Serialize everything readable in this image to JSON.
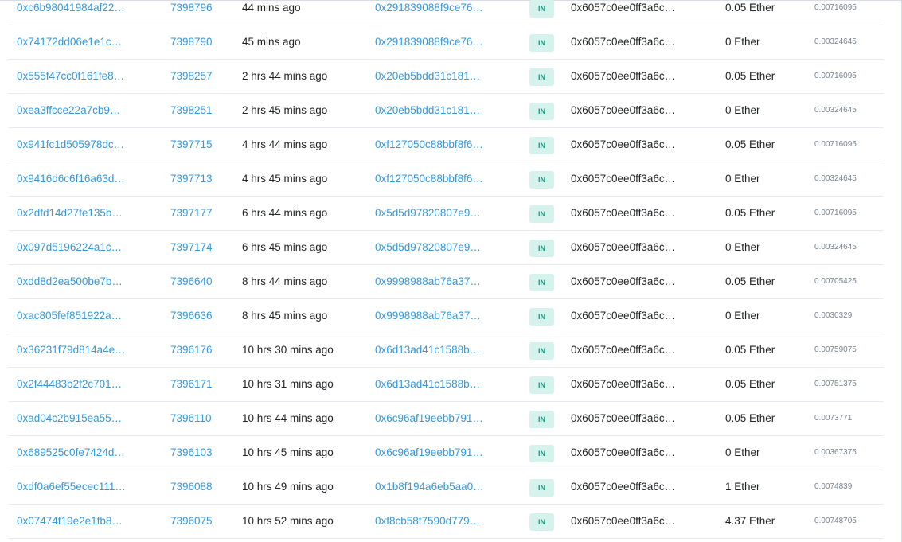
{
  "transactions": [
    {
      "hash": "0xc6b98041984af22…",
      "block": "7398796",
      "age": "44 mins ago",
      "from": "0x291839088f9ce76…",
      "direction": "IN",
      "to": "0x6057c0ee0ff3a6c…",
      "value": "0.05 Ether",
      "fee": "0.00716095"
    },
    {
      "hash": "0x74172dd06e1e1c…",
      "block": "7398790",
      "age": "45 mins ago",
      "from": "0x291839088f9ce76…",
      "direction": "IN",
      "to": "0x6057c0ee0ff3a6c…",
      "value": "0 Ether",
      "fee": "0.00324645"
    },
    {
      "hash": "0x555f47cc0f161fe8…",
      "block": "7398257",
      "age": "2 hrs 44 mins ago",
      "from": "0x20eb5bdd31c181…",
      "direction": "IN",
      "to": "0x6057c0ee0ff3a6c…",
      "value": "0.05 Ether",
      "fee": "0.00716095"
    },
    {
      "hash": "0xea3ffcce22a7cb9…",
      "block": "7398251",
      "age": "2 hrs 45 mins ago",
      "from": "0x20eb5bdd31c181…",
      "direction": "IN",
      "to": "0x6057c0ee0ff3a6c…",
      "value": "0 Ether",
      "fee": "0.00324645"
    },
    {
      "hash": "0x941fc1d505978dc…",
      "block": "7397715",
      "age": "4 hrs 44 mins ago",
      "from": "0xf127050c88bbf8f6…",
      "direction": "IN",
      "to": "0x6057c0ee0ff3a6c…",
      "value": "0.05 Ether",
      "fee": "0.00716095"
    },
    {
      "hash": "0x9416d6c6f16a63d…",
      "block": "7397713",
      "age": "4 hrs 45 mins ago",
      "from": "0xf127050c88bbf8f6…",
      "direction": "IN",
      "to": "0x6057c0ee0ff3a6c…",
      "value": "0 Ether",
      "fee": "0.00324645"
    },
    {
      "hash": "0x2dfd14d27fe135b…",
      "block": "7397177",
      "age": "6 hrs 44 mins ago",
      "from": "0x5d5d97820807e9…",
      "direction": "IN",
      "to": "0x6057c0ee0ff3a6c…",
      "value": "0.05 Ether",
      "fee": "0.00716095"
    },
    {
      "hash": "0x097d5196224a1c…",
      "block": "7397174",
      "age": "6 hrs 45 mins ago",
      "from": "0x5d5d97820807e9…",
      "direction": "IN",
      "to": "0x6057c0ee0ff3a6c…",
      "value": "0 Ether",
      "fee": "0.00324645"
    },
    {
      "hash": "0xdd8d2ea500be7b…",
      "block": "7396640",
      "age": "8 hrs 44 mins ago",
      "from": "0x9998988ab76a37…",
      "direction": "IN",
      "to": "0x6057c0ee0ff3a6c…",
      "value": "0.05 Ether",
      "fee": "0.00705425"
    },
    {
      "hash": "0xac805fef851922a…",
      "block": "7396636",
      "age": "8 hrs 45 mins ago",
      "from": "0x9998988ab76a37…",
      "direction": "IN",
      "to": "0x6057c0ee0ff3a6c…",
      "value": "0 Ether",
      "fee": "0.0030329"
    },
    {
      "hash": "0x36231f79d814a4e…",
      "block": "7396176",
      "age": "10 hrs 30 mins ago",
      "from": "0x6d13ad41c1588b…",
      "direction": "IN",
      "to": "0x6057c0ee0ff3a6c…",
      "value": "0.05 Ether",
      "fee": "0.00759075"
    },
    {
      "hash": "0x2f44483b2f2c701…",
      "block": "7396171",
      "age": "10 hrs 31 mins ago",
      "from": "0x6d13ad41c1588b…",
      "direction": "IN",
      "to": "0x6057c0ee0ff3a6c…",
      "value": "0.05 Ether",
      "fee": "0.00751375"
    },
    {
      "hash": "0xad04c2b915ea55…",
      "block": "7396110",
      "age": "10 hrs 44 mins ago",
      "from": "0x6c96af19eebb791…",
      "direction": "IN",
      "to": "0x6057c0ee0ff3a6c…",
      "value": "0.05 Ether",
      "fee": "0.0073771"
    },
    {
      "hash": "0x689525c0fe7424d…",
      "block": "7396103",
      "age": "10 hrs 45 mins ago",
      "from": "0x6c96af19eebb791…",
      "direction": "IN",
      "to": "0x6057c0ee0ff3a6c…",
      "value": "0 Ether",
      "fee": "0.00367375"
    },
    {
      "hash": "0xdf0a6ef55ecec111…",
      "block": "7396088",
      "age": "10 hrs 49 mins ago",
      "from": "0x1b8f194a6eb5aa0…",
      "direction": "IN",
      "to": "0x6057c0ee0ff3a6c…",
      "value": "1 Ether",
      "fee": "0.0074839"
    },
    {
      "hash": "0x07474f19e2e1fb8…",
      "block": "7396075",
      "age": "10 hrs 52 mins ago",
      "from": "0xf8cb58f7590d779…",
      "direction": "IN",
      "to": "0x6057c0ee0ff3a6c…",
      "value": "4.37 Ether",
      "fee": "0.00748705"
    }
  ],
  "colors": {
    "link": "#3498db",
    "badge_text": "#00a186",
    "badge_bg": "#d6f2ec",
    "row_border": "#e7eaf3"
  }
}
